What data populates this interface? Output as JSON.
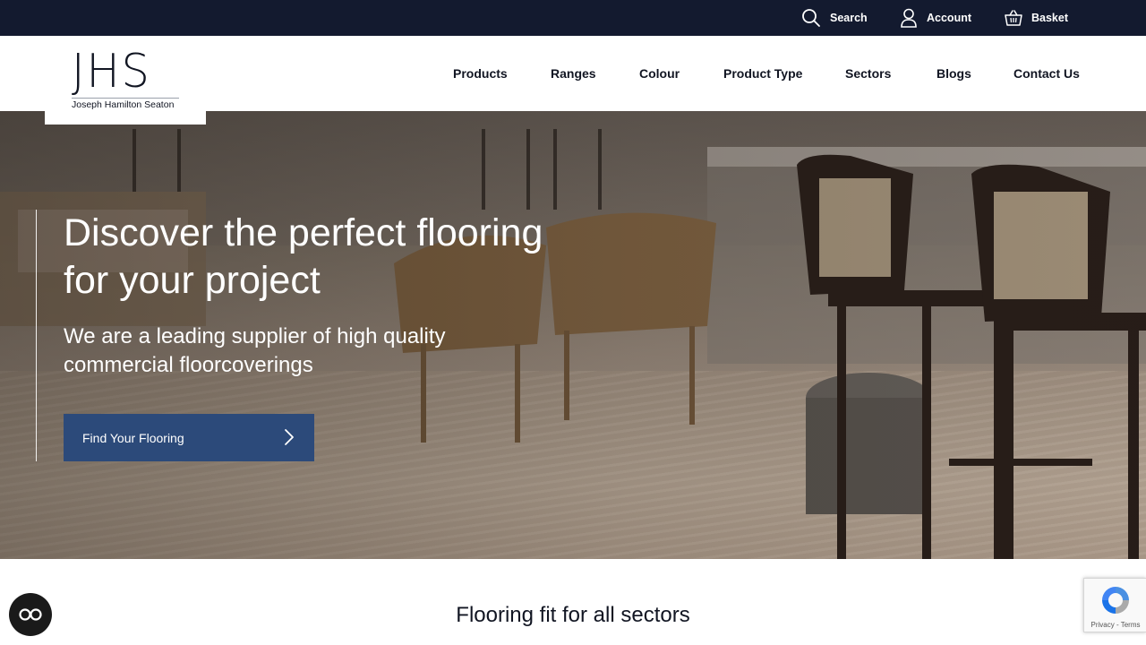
{
  "topbar": {
    "search_label": "Search",
    "account_label": "Account",
    "basket_label": "Basket",
    "icons": [
      "search-icon",
      "user-icon",
      "basket-icon"
    ],
    "background": "#131a2f"
  },
  "logo": {
    "mark": "JHS",
    "text": "Joseph Hamilton Seaton"
  },
  "nav": {
    "items": [
      {
        "label": "Products"
      },
      {
        "label": "Ranges"
      },
      {
        "label": "Colour"
      },
      {
        "label": "Product Type"
      },
      {
        "label": "Sectors"
      },
      {
        "label": "Blogs"
      },
      {
        "label": "Contact Us"
      }
    ]
  },
  "hero": {
    "title_line1": "Discover the perfect flooring",
    "title_line2": "for your project",
    "subtitle_line1": "We are a leading supplier of high quality",
    "subtitle_line2": "commercial floorcoverings",
    "cta_label": "Find Your Flooring",
    "cta_icon": "chevron-right-icon",
    "cta_color": "#2c4a7a"
  },
  "section": {
    "title": "Flooring fit for all sectors"
  },
  "widgets": {
    "accessibility_icon": "accessibility-icon",
    "recaptcha_terms": "Privacy - Terms"
  }
}
